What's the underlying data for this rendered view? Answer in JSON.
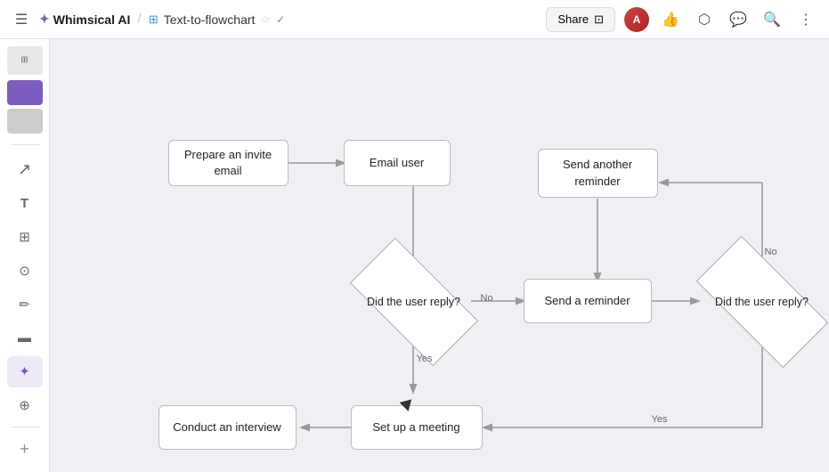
{
  "header": {
    "nav_label": "≡",
    "brand_icon": "✦",
    "brand_name": "Whimsical AI",
    "separator": "/",
    "doc_icon": "▣",
    "doc_title": "Text-to-flowchart",
    "star_label": "☆",
    "verified_label": "✓",
    "share_label": "Share",
    "share_icon": "⊡",
    "thumbs_up": "👍",
    "present_icon": "▶",
    "chat_icon": "💬",
    "search_icon": "🔍",
    "more_icon": "⋮"
  },
  "sidebar": {
    "items": [
      {
        "icon": "→",
        "name": "navigate"
      },
      {
        "icon": "□",
        "name": "frame"
      },
      {
        "icon": "T",
        "name": "text"
      },
      {
        "icon": "⊞",
        "name": "grid"
      },
      {
        "icon": "⊙",
        "name": "link"
      },
      {
        "icon": "✏",
        "name": "draw"
      },
      {
        "icon": "▬",
        "name": "shape"
      },
      {
        "icon": "✦",
        "name": "ai"
      },
      {
        "icon": "⊕",
        "name": "add"
      }
    ]
  },
  "flowchart": {
    "nodes": [
      {
        "id": "prepare",
        "label": "Prepare an invite\nemail"
      },
      {
        "id": "email",
        "label": "Email user"
      },
      {
        "id": "send-reminder",
        "label": "Send a reminder"
      },
      {
        "id": "send-another",
        "label": "Send another\nreminder"
      },
      {
        "id": "setup",
        "label": "Set up a meeting"
      },
      {
        "id": "interview",
        "label": "Conduct an interview"
      }
    ],
    "diamonds": [
      {
        "id": "reply1",
        "label": "Did the user reply?"
      },
      {
        "id": "reply2",
        "label": "Did the user reply?"
      }
    ],
    "edge_labels": {
      "no1": "No",
      "yes1": "Yes",
      "no2": "No",
      "yes2": "Yes"
    }
  }
}
